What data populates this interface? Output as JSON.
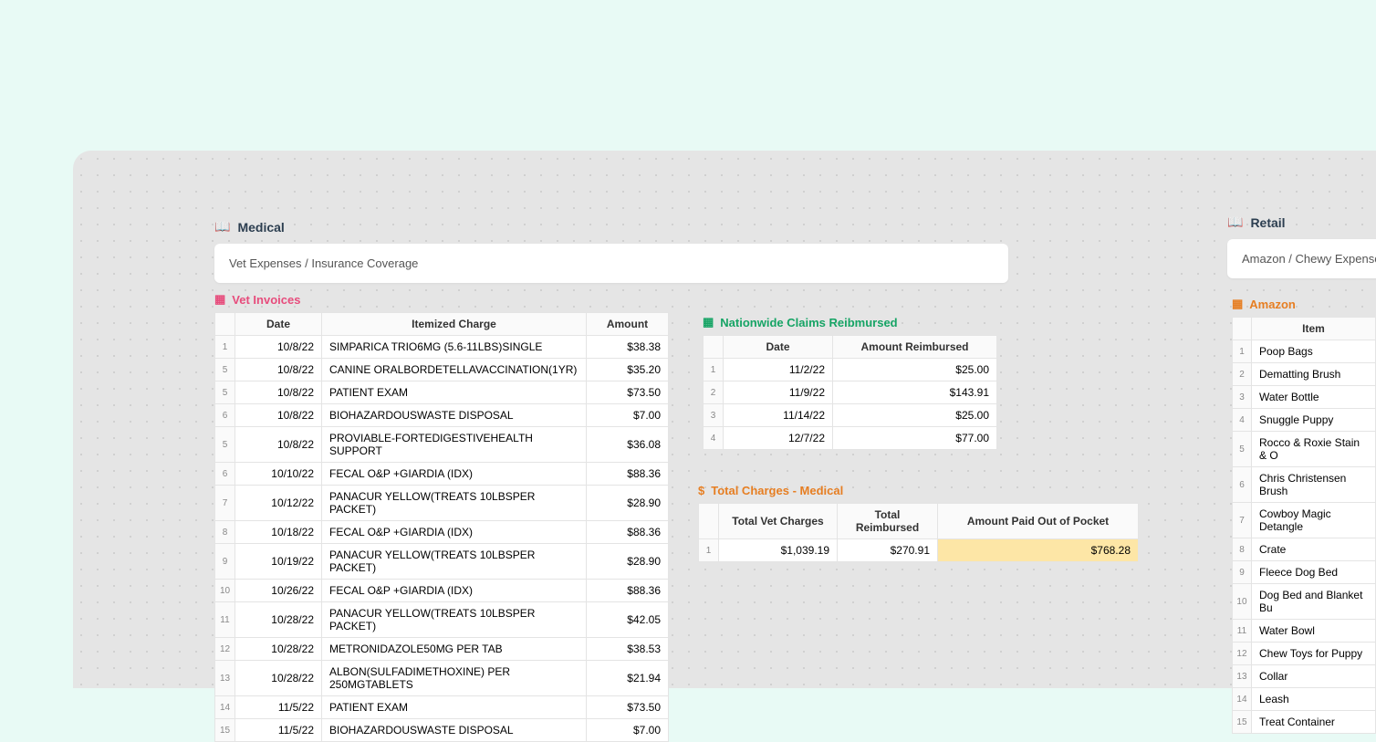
{
  "medical": {
    "title": "Medical",
    "note": "Vet Expenses / Insurance Coverage"
  },
  "vet_invoices": {
    "title": "Vet Invoices",
    "headers": {
      "date": "Date",
      "charge": "Itemized Charge",
      "amount": "Amount"
    },
    "rows": [
      {
        "n": "1",
        "date": "10/8/22",
        "charge": "SIMPARICA TRIO6MG (5.6-11LBS)SINGLE",
        "amount": "$38.38"
      },
      {
        "n": "5",
        "date": "10/8/22",
        "charge": "CANINE ORALBORDETELLAVACCINATION(1YR)",
        "amount": "$35.20"
      },
      {
        "n": "5",
        "date": "10/8/22",
        "charge": "PATIENT EXAM",
        "amount": "$73.50"
      },
      {
        "n": "6",
        "date": "10/8/22",
        "charge": "BIOHAZARDOUSWASTE DISPOSAL",
        "amount": "$7.00"
      },
      {
        "n": "5",
        "date": "10/8/22",
        "charge": "PROVIABLE-FORTEDIGESTIVEHEALTH SUPPORT",
        "amount": "$36.08"
      },
      {
        "n": "6",
        "date": "10/10/22",
        "charge": "FECAL O&P +GIARDIA (IDX)",
        "amount": "$88.36"
      },
      {
        "n": "7",
        "date": "10/12/22",
        "charge": "PANACUR YELLOW(TREATS 10LBSPER PACKET)",
        "amount": "$28.90"
      },
      {
        "n": "8",
        "date": "10/18/22",
        "charge": "FECAL O&P +GIARDIA (IDX)",
        "amount": "$88.36"
      },
      {
        "n": "9",
        "date": "10/19/22",
        "charge": "PANACUR YELLOW(TREATS 10LBSPER PACKET)",
        "amount": "$28.90"
      },
      {
        "n": "10",
        "date": "10/26/22",
        "charge": "FECAL O&P +GIARDIA (IDX)",
        "amount": "$88.36"
      },
      {
        "n": "11",
        "date": "10/28/22",
        "charge": "PANACUR YELLOW(TREATS 10LBSPER PACKET)",
        "amount": "$42.05"
      },
      {
        "n": "12",
        "date": "10/28/22",
        "charge": "METRONIDAZOLE50MG PER TAB",
        "amount": "$38.53"
      },
      {
        "n": "13",
        "date": "10/28/22",
        "charge": "ALBON(SULFADIMETHOXINE) PER 250MGTABLETS",
        "amount": "$21.94"
      },
      {
        "n": "14",
        "date": "11/5/22",
        "charge": "PATIENT EXAM",
        "amount": "$73.50"
      },
      {
        "n": "15",
        "date": "11/5/22",
        "charge": "BIOHAZARDOUSWASTE DISPOSAL",
        "amount": "$7.00"
      }
    ]
  },
  "claims": {
    "title": "Nationwide Claims Reibmursed",
    "headers": {
      "date": "Date",
      "amount": "Amount Reimbursed"
    },
    "rows": [
      {
        "n": "1",
        "date": "11/2/22",
        "amount": "$25.00"
      },
      {
        "n": "2",
        "date": "11/9/22",
        "amount": "$143.91"
      },
      {
        "n": "3",
        "date": "11/14/22",
        "amount": "$25.00"
      },
      {
        "n": "4",
        "date": "12/7/22",
        "amount": "$77.00"
      }
    ]
  },
  "totals": {
    "title": "Total Charges - Medical",
    "headers": {
      "c1": "Total Vet Charges",
      "c2": "Total Reimbursed",
      "c3": "Amount Paid Out of Pocket"
    },
    "row": {
      "n": "1",
      "c1": "$1,039.19",
      "c2": "$270.91",
      "c3": "$768.28"
    }
  },
  "retail": {
    "title": "Retail",
    "note": "Amazon / Chewy Expenses"
  },
  "amazon": {
    "title": "Amazon",
    "headers": {
      "item": "Item"
    },
    "rows": [
      {
        "n": "1",
        "item": "Poop Bags"
      },
      {
        "n": "2",
        "item": "Dematting Brush"
      },
      {
        "n": "3",
        "item": "Water Bottle"
      },
      {
        "n": "4",
        "item": "Snuggle Puppy"
      },
      {
        "n": "5",
        "item": "Rocco & Roxie Stain & O"
      },
      {
        "n": "6",
        "item": "Chris Christensen Brush"
      },
      {
        "n": "7",
        "item": "Cowboy Magic Detangle"
      },
      {
        "n": "8",
        "item": "Crate"
      },
      {
        "n": "9",
        "item": "Fleece Dog Bed"
      },
      {
        "n": "10",
        "item": "Dog Bed and Blanket Bu"
      },
      {
        "n": "11",
        "item": "Water Bowl"
      },
      {
        "n": "12",
        "item": "Chew Toys for Puppy"
      },
      {
        "n": "13",
        "item": "Collar"
      },
      {
        "n": "14",
        "item": "Leash"
      },
      {
        "n": "15",
        "item": "Treat Container"
      }
    ]
  }
}
